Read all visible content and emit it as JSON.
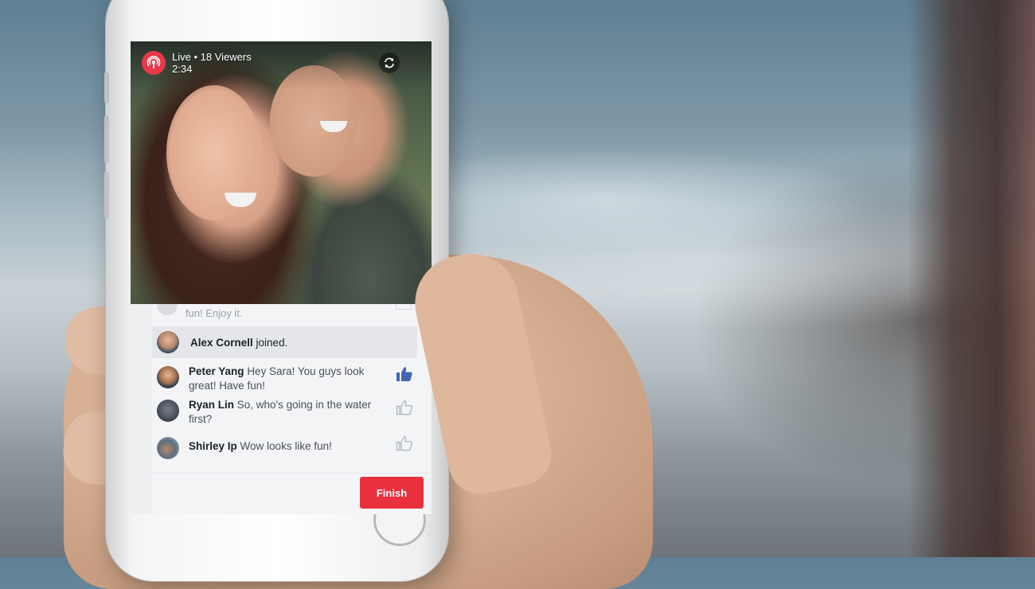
{
  "live": {
    "status": "Live • 18 Viewers",
    "duration": "2:34"
  },
  "comments": {
    "partial_text": "fun! Enjoy it.",
    "joined": {
      "name": "Alex Cornell",
      "action": "joined."
    },
    "items": [
      {
        "name": "Peter Yang",
        "text": "Hey Sara! You guys look great! Have fun!",
        "liked": true
      },
      {
        "name": "Ryan Lin",
        "text": "So, who's going in the water first?",
        "liked": false
      },
      {
        "name": "Shirley Ip",
        "text": "Wow looks like fun!",
        "liked": false
      }
    ]
  },
  "footer": {
    "finish_label": "Finish"
  },
  "colors": {
    "live_red": "#e8384a",
    "finish_red": "#e8303f",
    "like_blue": "#4267b2"
  },
  "icons": {
    "live": "live-broadcast-icon",
    "flip": "camera-flip-icon",
    "like": "thumbs-up-icon"
  }
}
